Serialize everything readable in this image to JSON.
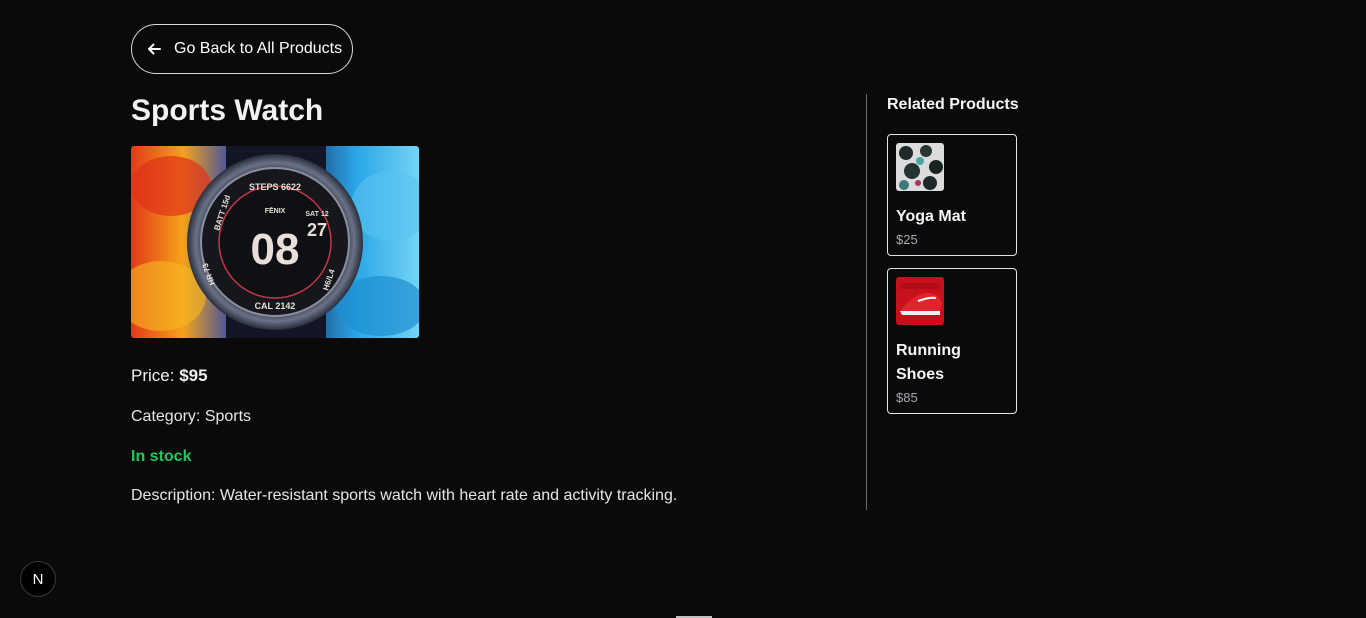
{
  "back_button": {
    "label": "Go Back to All Products",
    "icon": "arrow-left-icon"
  },
  "product": {
    "name": "Sports Watch",
    "image": "sports-watch-image",
    "image_text": {
      "steps": "STEPS 6622",
      "brand": "FĒNIX",
      "date": "SAT 12",
      "hour": "08",
      "minute": "27",
      "battery": "BATT 15d",
      "heart": "HR 73",
      "altitude": "H6/L4",
      "calories": "CAL 2142"
    },
    "price_label": "Price: ",
    "price_value": "$95",
    "category": "Category: Sports",
    "stock": "In stock",
    "description": "Description: Water-resistant sports watch with heart rate and activity tracking."
  },
  "related": {
    "title": "Related Products",
    "items": [
      {
        "name": "Yoga Mat",
        "price": "$25",
        "image": "yoga-mat-image"
      },
      {
        "name": "Running Shoes",
        "price": "$85",
        "image": "running-shoes-image"
      }
    ]
  },
  "next_badge": {
    "letter": "N"
  },
  "colors": {
    "background": "#0a0a0a",
    "stock_green": "#22c55e",
    "muted_price": "#a8a8b3",
    "border": "#e4e4e4"
  }
}
